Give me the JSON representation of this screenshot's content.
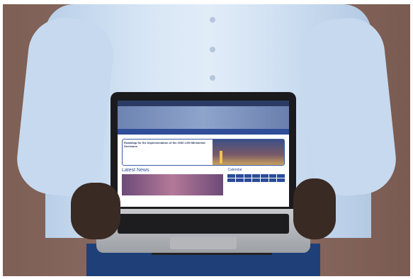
{
  "image": {
    "type": "photo",
    "subject": "person holding laptop showing website"
  },
  "website": {
    "top_bar": "",
    "title": "",
    "nav_items": [
      "",
      "",
      "",
      "",
      "",
      ""
    ],
    "tabs": [
      "",
      "",
      ""
    ],
    "feature_title": "Roadmap for the Implementation of the 2030 LVM Ministerial Decisions",
    "latest_news": "Latest News",
    "calendar": "Calendar"
  },
  "colors": {
    "shirt": "#d6e5f5",
    "site_accent": "#2b4c9a"
  }
}
